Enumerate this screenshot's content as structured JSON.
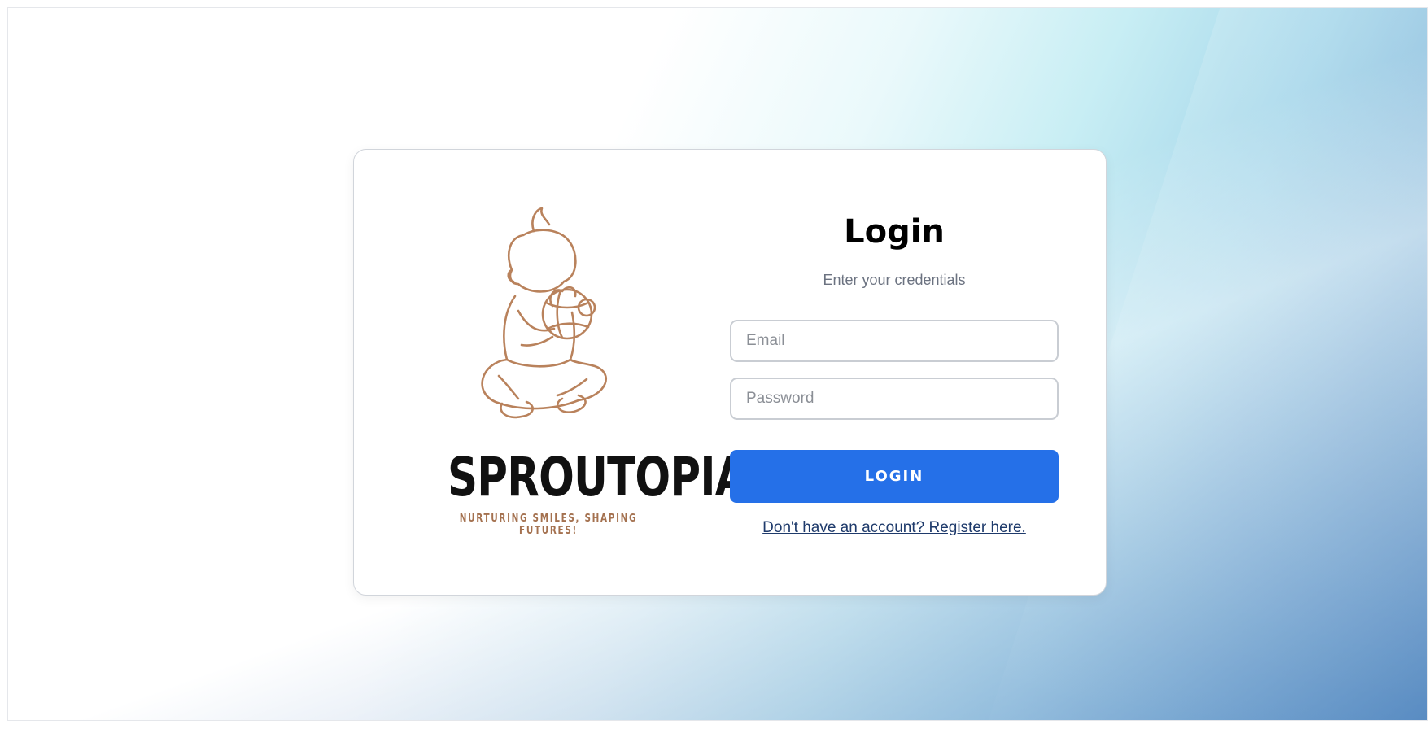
{
  "brand": {
    "name": "SPROUTOPIA",
    "tagline": "NURTURING SMILES, SHAPING FUTURES!",
    "logo_icon": "baby-with-ball-icon",
    "colors": {
      "name": "#111111",
      "tagline": "#a4714f",
      "logo_stroke": "#b9825c"
    }
  },
  "login": {
    "title": "Login",
    "subtitle": "Enter your credentials",
    "email_placeholder": "Email",
    "password_placeholder": "Password",
    "submit_label": "LOGIN",
    "register_text": "Don't have an account? Register here."
  },
  "colors": {
    "primary_button": "#2570e8",
    "link": "#1e3a6b"
  }
}
